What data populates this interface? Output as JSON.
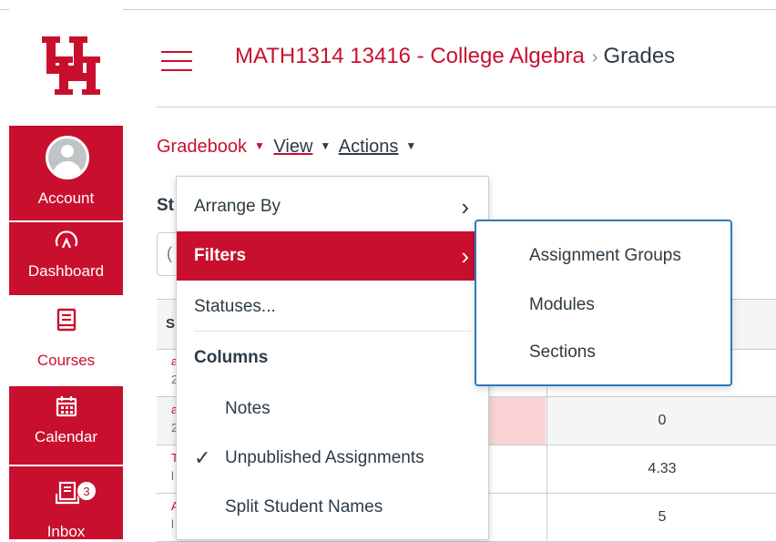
{
  "brand": {
    "accent": "#c8102e",
    "focus": "#2b7abc",
    "logo_text": "UH"
  },
  "global_nav": {
    "account": {
      "label": "Account",
      "icon": "user-avatar-icon"
    },
    "dashboard": {
      "label": "Dashboard",
      "icon": "speedometer-icon"
    },
    "courses": {
      "label": "Courses",
      "icon": "book-icon"
    },
    "calendar": {
      "label": "Calendar",
      "icon": "calendar-icon"
    },
    "inbox": {
      "label": "Inbox",
      "icon": "inbox-icon",
      "badge": "3"
    }
  },
  "header": {
    "course": "MATH1314 13416 - College Algebra",
    "separator": "›",
    "current": "Grades"
  },
  "gradebook_menu": {
    "gradebook": "Gradebook",
    "view": "View",
    "actions": "Actions"
  },
  "background": {
    "heading_fragment": "St",
    "search_fragment": "(",
    "header_fragment": "S",
    "rows": [
      {
        "name_top": "a",
        "name_bottom": "2",
        "value": ""
      },
      {
        "name_top": "a",
        "name_bottom": "2",
        "value": "0"
      },
      {
        "name_top": "T",
        "name_bottom": "l",
        "value": "4.33"
      },
      {
        "name_top": "A",
        "name_bottom": "l",
        "value": "5"
      }
    ]
  },
  "view_menu": {
    "arrange_by": "Arrange By",
    "filters": "Filters",
    "statuses": "Statuses...",
    "columns_heading": "Columns",
    "notes": "Notes",
    "unpublished": "Unpublished Assignments",
    "split_names": "Split Student Names",
    "chevron": "›",
    "check": "✓"
  },
  "filters_submenu": {
    "items": [
      "Assignment Groups",
      "Modules",
      "Sections"
    ]
  }
}
